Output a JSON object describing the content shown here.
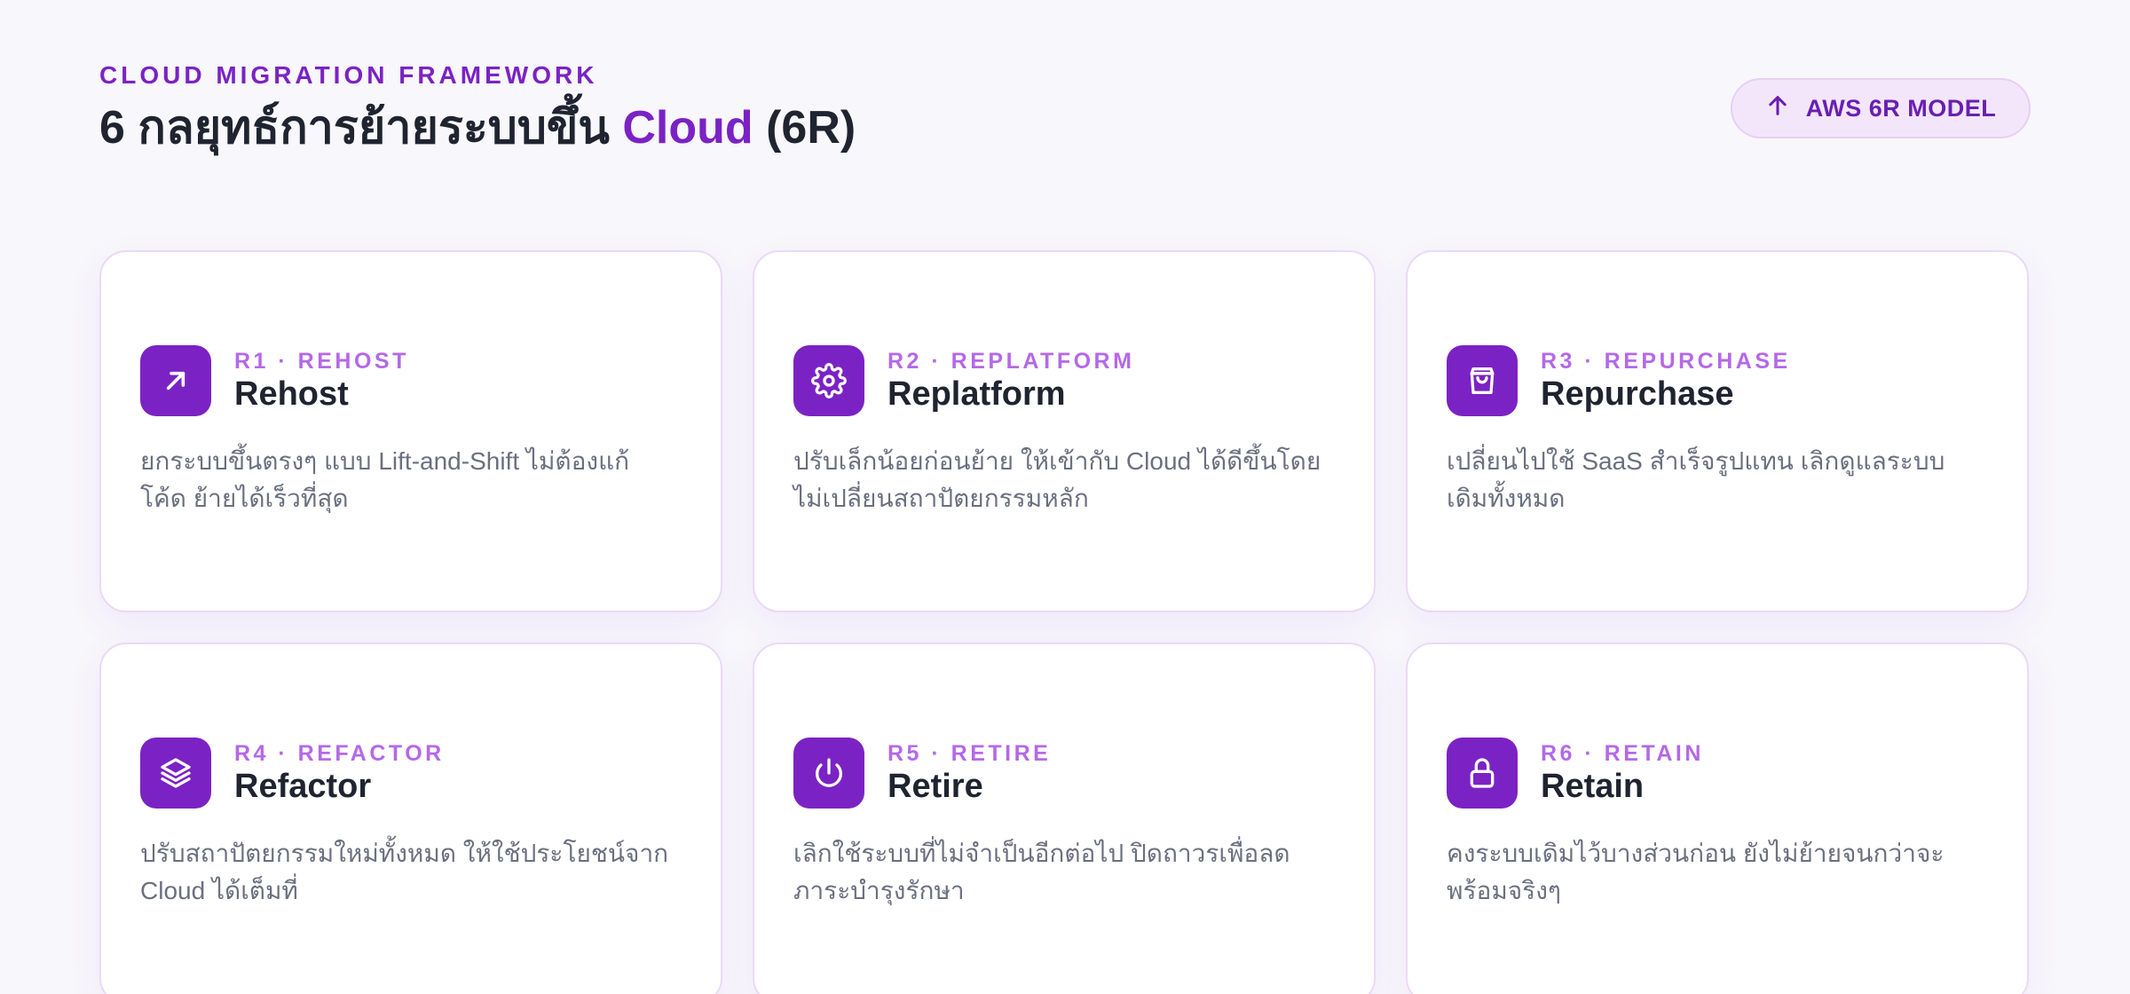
{
  "header": {
    "eyebrow": "CLOUD MIGRATION FRAMEWORK",
    "title_prefix": "6 กลยุทธ์การย้ายระบบขึ้น ",
    "title_accent": "Cloud",
    "title_suffix": " (6R)",
    "badge_label": "AWS 6R MODEL",
    "badge_icon": "arrow-up-icon"
  },
  "colors": {
    "accent": "#7b22c4",
    "accent_light": "#b568e8",
    "badge_bg": "#f3e6fb",
    "text_dark": "#1f2430",
    "text_muted": "#6b7080",
    "page_bg": "#f8f7fb"
  },
  "cards": [
    {
      "code": "R1 · REHOST",
      "name": "Rehost",
      "icon": "arrow-up-right-icon",
      "description": "ยกระบบขึ้นตรงๆ แบบ Lift-and-Shift ไม่ต้องแก้โค้ด ย้ายได้เร็วที่สุด"
    },
    {
      "code": "R2 · REPLATFORM",
      "name": "Replatform",
      "icon": "gear-icon",
      "description": "ปรับเล็กน้อยก่อนย้าย ให้เข้ากับ Cloud ได้ดีขึ้นโดยไม่เปลี่ยนสถาปัตยกรรมหลัก"
    },
    {
      "code": "R3 · REPURCHASE",
      "name": "Repurchase",
      "icon": "shopping-bag-icon",
      "description": "เปลี่ยนไปใช้ SaaS สำเร็จรูปแทน เลิกดูแลระบบเดิมทั้งหมด"
    },
    {
      "code": "R4 · REFACTOR",
      "name": "Refactor",
      "icon": "layers-icon",
      "description": "ปรับสถาปัตยกรรมใหม่ทั้งหมด ให้ใช้ประโยชน์จาก Cloud ได้เต็มที่"
    },
    {
      "code": "R5 · RETIRE",
      "name": "Retire",
      "icon": "power-icon",
      "description": "เลิกใช้ระบบที่ไม่จำเป็นอีกต่อไป ปิดถาวรเพื่อลดภาระบำรุงรักษา"
    },
    {
      "code": "R6 · RETAIN",
      "name": "Retain",
      "icon": "lock-icon",
      "description": "คงระบบเดิมไว้บางส่วนก่อน ยังไม่ย้ายจนกว่าจะพร้อมจริงๆ"
    }
  ]
}
